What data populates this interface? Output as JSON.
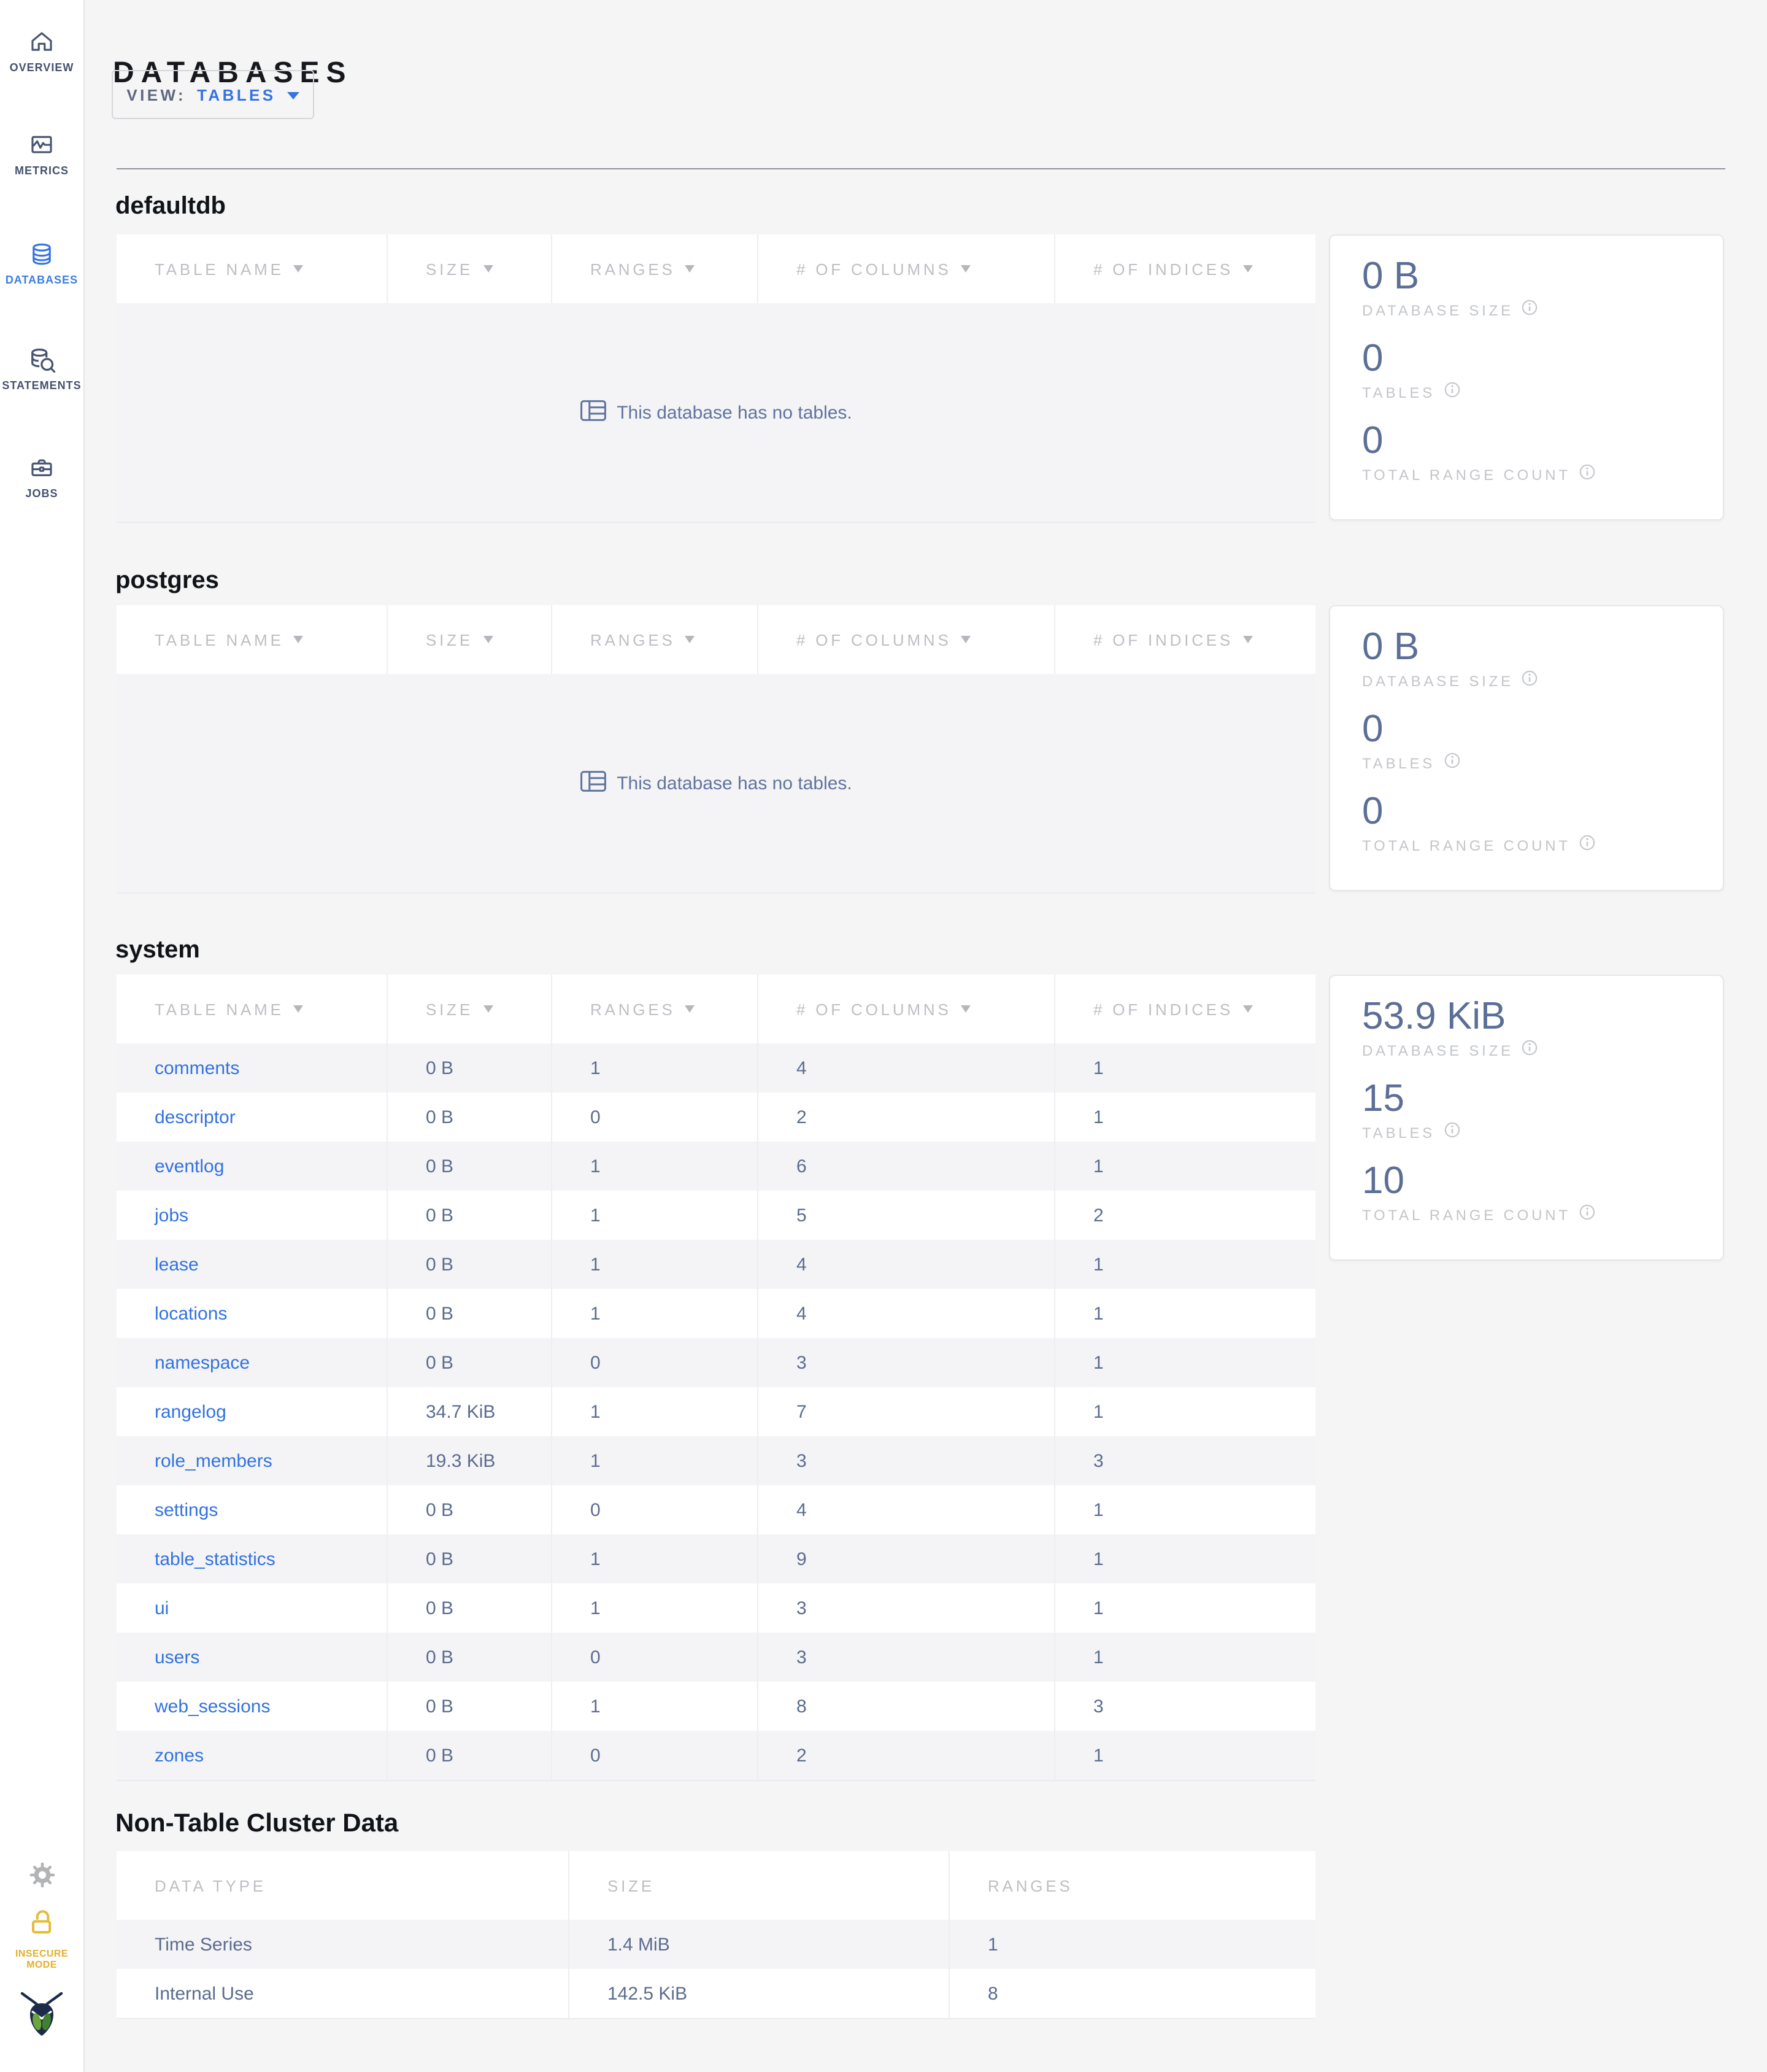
{
  "sidebar": {
    "items": [
      {
        "label": "OVERVIEW",
        "icon": "home-icon",
        "active": false
      },
      {
        "label": "METRICS",
        "icon": "metrics-icon",
        "active": false
      },
      {
        "label": "DATABASES",
        "icon": "databases-icon",
        "active": true
      },
      {
        "label": "STATEMENTS",
        "icon": "statements-icon",
        "active": false
      },
      {
        "label": "JOBS",
        "icon": "jobs-icon",
        "active": false
      }
    ],
    "insecure_mode_label": "INSECURE MODE"
  },
  "header": {
    "title": "DATABASES",
    "view_label": "VIEW:",
    "view_value": "TABLES"
  },
  "table_columns": [
    "TABLE NAME",
    "SIZE",
    "RANGES",
    "# OF COLUMNS",
    "# OF INDICES"
  ],
  "empty_message": "This database has no tables.",
  "databases": [
    {
      "name": "defaultdb",
      "empty": true,
      "rows": [],
      "stats": [
        {
          "value": "0 B",
          "label": "DATABASE SIZE"
        },
        {
          "value": "0",
          "label": "TABLES"
        },
        {
          "value": "0",
          "label": "TOTAL RANGE COUNT"
        }
      ]
    },
    {
      "name": "postgres",
      "empty": true,
      "rows": [],
      "stats": [
        {
          "value": "0 B",
          "label": "DATABASE SIZE"
        },
        {
          "value": "0",
          "label": "TABLES"
        },
        {
          "value": "0",
          "label": "TOTAL RANGE COUNT"
        }
      ]
    },
    {
      "name": "system",
      "empty": false,
      "rows": [
        [
          "comments",
          "0 B",
          "1",
          "4",
          "1"
        ],
        [
          "descriptor",
          "0 B",
          "0",
          "2",
          "1"
        ],
        [
          "eventlog",
          "0 B",
          "1",
          "6",
          "1"
        ],
        [
          "jobs",
          "0 B",
          "1",
          "5",
          "2"
        ],
        [
          "lease",
          "0 B",
          "1",
          "4",
          "1"
        ],
        [
          "locations",
          "0 B",
          "1",
          "4",
          "1"
        ],
        [
          "namespace",
          "0 B",
          "0",
          "3",
          "1"
        ],
        [
          "rangelog",
          "34.7 KiB",
          "1",
          "7",
          "1"
        ],
        [
          "role_members",
          "19.3 KiB",
          "1",
          "3",
          "3"
        ],
        [
          "settings",
          "0 B",
          "0",
          "4",
          "1"
        ],
        [
          "table_statistics",
          "0 B",
          "1",
          "9",
          "1"
        ],
        [
          "ui",
          "0 B",
          "1",
          "3",
          "1"
        ],
        [
          "users",
          "0 B",
          "0",
          "3",
          "1"
        ],
        [
          "web_sessions",
          "0 B",
          "1",
          "8",
          "3"
        ],
        [
          "zones",
          "0 B",
          "0",
          "2",
          "1"
        ]
      ],
      "stats": [
        {
          "value": "53.9 KiB",
          "label": "DATABASE SIZE"
        },
        {
          "value": "15",
          "label": "TABLES"
        },
        {
          "value": "10",
          "label": "TOTAL RANGE COUNT"
        }
      ]
    }
  ],
  "non_table": {
    "title": "Non-Table Cluster Data",
    "columns": [
      "DATA TYPE",
      "SIZE",
      "RANGES"
    ],
    "rows": [
      [
        "Time Series",
        "1.4 MiB",
        "1"
      ],
      [
        "Internal Use",
        "142.5 KiB",
        "8"
      ]
    ]
  },
  "colors": {
    "accent_blue": "#3573e2",
    "link_blue": "#3272e0",
    "slate": "#5b6e96",
    "insecure_yellow": "#e2b02a",
    "page_bg": "#f5f5f6"
  }
}
